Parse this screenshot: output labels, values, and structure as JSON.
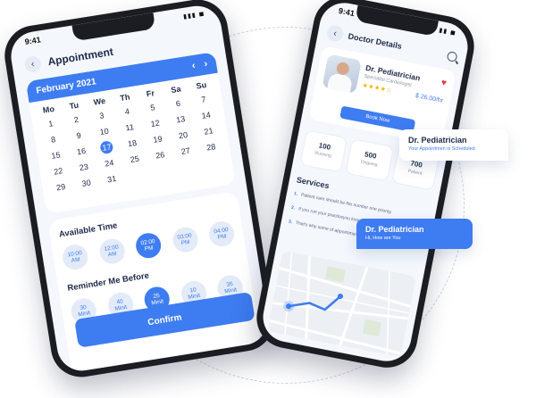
{
  "colors": {
    "accent": "#3e7cf1",
    "heart": "#e23744",
    "star": "#f5b301"
  },
  "left_phone": {
    "status_time": "9:41",
    "header": {
      "title": "Appointment",
      "back_icon": "chevron-left-icon"
    },
    "calendar": {
      "month": "February 2021",
      "weekdays": [
        "Mo",
        "Tu",
        "We",
        "Th",
        "Fr",
        "Sa",
        "Su"
      ],
      "days": [
        "1",
        "2",
        "3",
        "4",
        "5",
        "6",
        "7",
        "8",
        "9",
        "10",
        "11",
        "12",
        "13",
        "14",
        "15",
        "16",
        "17",
        "18",
        "19",
        "20",
        "21",
        "22",
        "23",
        "24",
        "25",
        "26",
        "27",
        "28",
        "29",
        "30",
        "31"
      ],
      "selected_day": "17"
    },
    "available_time": {
      "title": "Available Time",
      "slots": [
        {
          "time": "10:00",
          "period": "AM",
          "active": false
        },
        {
          "time": "12:00",
          "period": "AM",
          "active": false
        },
        {
          "time": "02:00",
          "period": "PM",
          "active": true
        },
        {
          "time": "03:00",
          "period": "PM",
          "active": false
        },
        {
          "time": "04:00",
          "period": "PM",
          "active": false
        }
      ]
    },
    "reminder": {
      "title": "Reminder Me Before",
      "options": [
        {
          "value": "30",
          "unit": "Minit",
          "active": false
        },
        {
          "value": "40",
          "unit": "Minit",
          "active": false
        },
        {
          "value": "25",
          "unit": "Minit",
          "active": true
        },
        {
          "value": "10",
          "unit": "Minit",
          "active": false
        },
        {
          "value": "35",
          "unit": "Minit",
          "active": false
        }
      ]
    },
    "confirm_label": "Confirm"
  },
  "right_phone": {
    "status_time": "9:41",
    "header": {
      "title": "Doctor Details"
    },
    "doctor": {
      "name": "Dr. Pediatrician",
      "specialty": "Specialist Cardiologist",
      "price": "$ 26.00/hr",
      "book_label": "Book Now"
    },
    "stats": [
      {
        "value": "100",
        "label": "Running"
      },
      {
        "value": "500",
        "label": "Ongoing"
      },
      {
        "value": "700",
        "label": "Patient"
      }
    ],
    "services": {
      "title": "Services",
      "items": [
        {
          "num": "1.",
          "text": "Patient care should be the number one priority."
        },
        {
          "num": "2.",
          "text": "If you run your practiceyou know how frustrati"
        },
        {
          "num": "3.",
          "text": "That's why some of appointment reminder"
        }
      ]
    }
  },
  "bubbles": [
    {
      "name": "Dr. Pediatrician",
      "message": "Your Appointmen is Scheduled"
    },
    {
      "name": "Dr. Pediatrician",
      "message": "Hi, How are You"
    }
  ]
}
